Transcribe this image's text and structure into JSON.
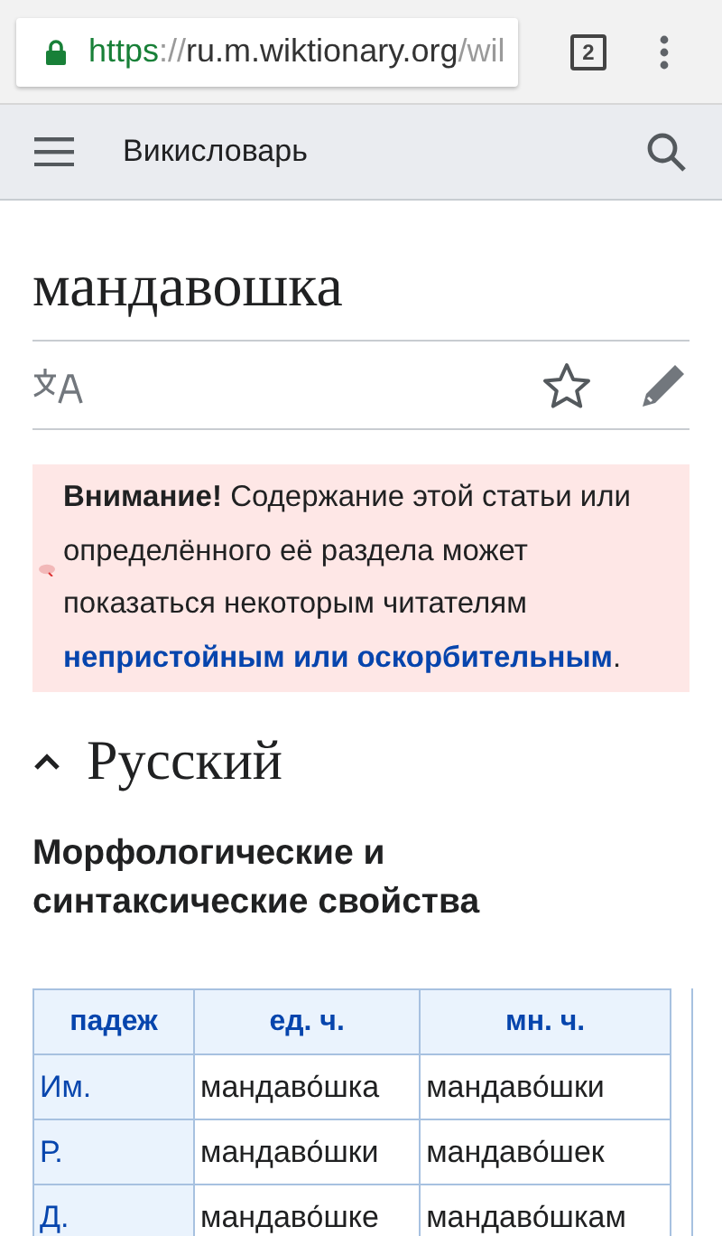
{
  "browser": {
    "url": {
      "scheme": "https",
      "separator": "://",
      "host": "ru.m.wiktionary.org",
      "path": "/wil"
    },
    "tab_count": "2"
  },
  "header": {
    "title": "Викисловарь"
  },
  "page": {
    "title": "мандавошка"
  },
  "notice": {
    "text": "**Внимание!** Содержание этой статьи или определённого её раздела может показаться некоторым читателям ",
    "link": "непристойным или оскорбительным",
    "tail": "."
  },
  "section": {
    "title": "Русский",
    "expanded": true
  },
  "subsection": {
    "title": "Морфологические и синтаксические свойства"
  },
  "table": {
    "columns": [
      "падеж",
      "ед. ч.",
      "мн. ч."
    ],
    "rows": [
      [
        "Им.",
        "мандаво́шка",
        "мандаво́шки"
      ],
      [
        "Р.",
        "мандаво́шки",
        "мандаво́шек"
      ],
      [
        "Д.",
        "мандаво́шке",
        "мандаво́шкам"
      ]
    ]
  }
}
